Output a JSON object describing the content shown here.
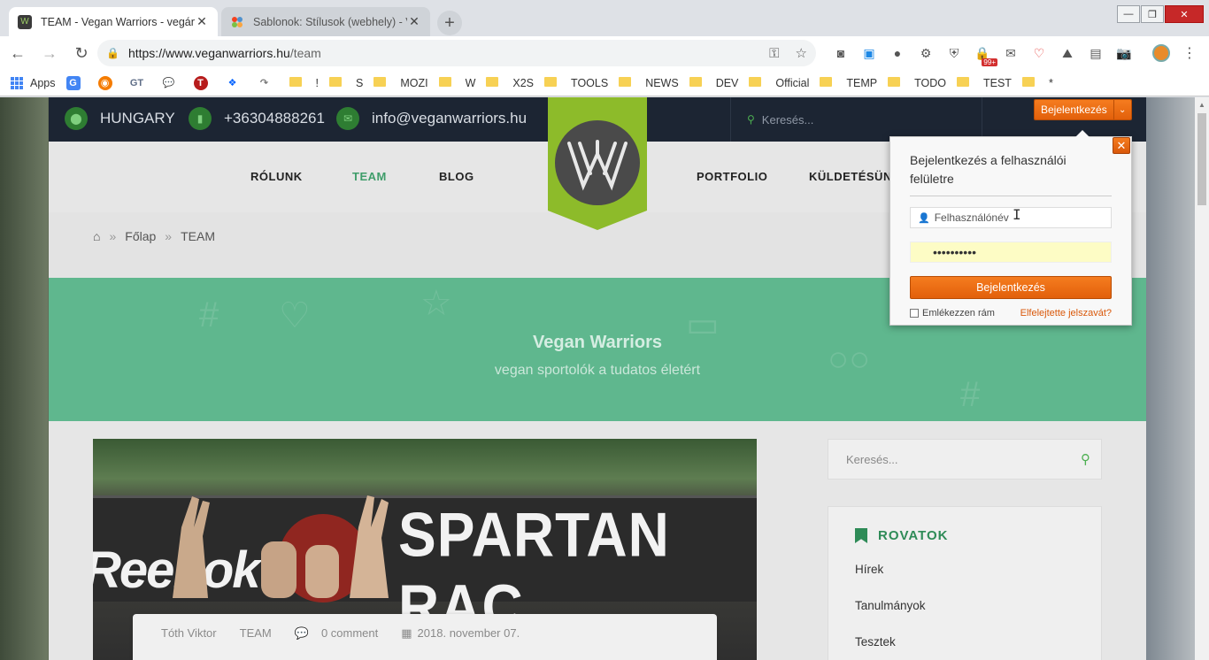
{
  "browser": {
    "tabs": [
      {
        "title": "TEAM - Vegan Warriors - vegán s",
        "close": "✕"
      },
      {
        "title": "Sablonok: Stílusok (webhely) - Ve",
        "close": "✕"
      }
    ],
    "new_tab": "+",
    "window_controls": {
      "minimize": "—",
      "maximize": "❐",
      "close": "✕"
    },
    "nav": {
      "back": "←",
      "forward": "→",
      "reload": "↻"
    },
    "address": {
      "host": "https://www.veganwarriors.hu",
      "path": "/team"
    },
    "badge_count": "99+",
    "bookmarks": {
      "apps": "Apps",
      "gt": "GT",
      "folders": [
        "!",
        "S",
        "MOZI",
        "W",
        "X2S",
        "TOOLS",
        "NEWS",
        "DEV",
        "Official",
        "TEMP",
        "TODO",
        "TEST",
        "*"
      ]
    }
  },
  "site": {
    "topbar": {
      "country": "HUNGARY",
      "phone": "+36304888261",
      "email": "info@veganwarriors.hu",
      "search_placeholder": "Keresés...",
      "login_button": "Bejelentkezés"
    },
    "nav": {
      "items": [
        "RÓLUNK",
        "TEAM",
        "BLOG",
        "PORTFOLIO",
        "KÜLDETÉSÜNK"
      ],
      "active": "TEAM"
    },
    "breadcrumb": {
      "home": "Főlap",
      "current": "TEAM",
      "sep": "»"
    },
    "hero": {
      "title": "Vegan Warriors",
      "subtitle": "vegan sportolók a tudatos életért"
    },
    "post": {
      "image_text_left": "Reebok",
      "image_text_right": "SPARTAN RAC",
      "author": "Tóth Viktor",
      "category": "TEAM",
      "comments": "0 comment",
      "date": "2018. november 07."
    },
    "sidebar": {
      "search_placeholder": "Keresés...",
      "rovatok_title": "ROVATOK",
      "categories": [
        "Hírek",
        "Tanulmányok",
        "Tesztek"
      ]
    },
    "login_popup": {
      "title": "Bejelentkezés a felhasználói felületre",
      "username_placeholder": "Felhasználónév",
      "password_value": "••••••••••",
      "submit": "Bejelentkezés",
      "remember": "Emlékezzen rám",
      "forgot": "Elfelejtette jelszavát?",
      "close": "✕"
    }
  },
  "colors": {
    "accent_orange": "#e2600b",
    "brand_green": "#3f9d6a",
    "hero_green": "#5fb78e",
    "topbar_navy": "#1c2533"
  }
}
